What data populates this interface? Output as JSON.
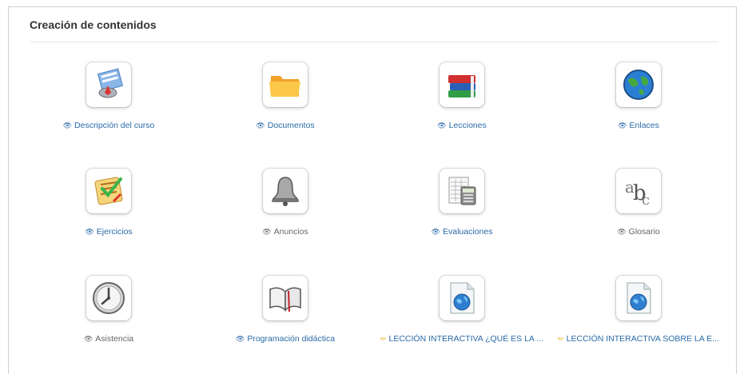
{
  "section": {
    "title": "Creación de contenidos"
  },
  "tools": [
    {
      "name": "Descripción del curso",
      "state": "visible",
      "icon": "course-description-icon"
    },
    {
      "name": "Documentos",
      "state": "visible",
      "icon": "folder-icon"
    },
    {
      "name": "Lecciones",
      "state": "visible",
      "icon": "books-icon"
    },
    {
      "name": "Enlaces",
      "state": "visible",
      "icon": "globe-icon"
    },
    {
      "name": "Ejercicios",
      "state": "visible",
      "icon": "checklist-icon"
    },
    {
      "name": "Anuncios",
      "state": "hidden",
      "icon": "bell-icon"
    },
    {
      "name": "Evaluaciones",
      "state": "visible",
      "icon": "spreadsheet-calculator-icon"
    },
    {
      "name": "Glosario",
      "state": "hidden",
      "icon": "abc-icon"
    },
    {
      "name": "Asistencia",
      "state": "hidden",
      "icon": "clock-icon"
    },
    {
      "name": "Programación didáctica",
      "state": "visible",
      "icon": "open-book-icon"
    },
    {
      "name": "LECCIÓN INTERACTIVA ¿QUÉ ES LA ...",
      "state": "edit",
      "icon": "web-document-icon"
    },
    {
      "name": "LECCIÓN INTERACTIVA SOBRE LA E...",
      "state": "edit",
      "icon": "web-document-icon"
    }
  ],
  "colors": {
    "link": "#2a6aa8",
    "hidden_text": "#666666",
    "pencil": "#e8b62a"
  }
}
